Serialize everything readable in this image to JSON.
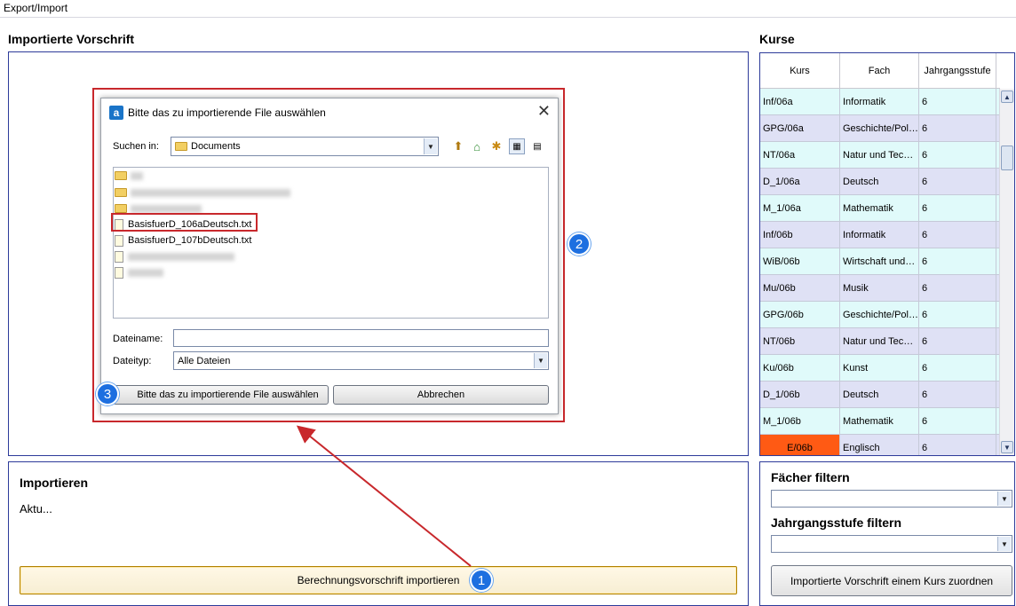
{
  "app": {
    "menu_title": "Export/Import"
  },
  "left_panel": {
    "title": "Importierte Vorschrift"
  },
  "courses": {
    "title": "Kurse",
    "columns": [
      "Kurs",
      "Fach",
      "Jahrgangsstufe"
    ],
    "rows": [
      {
        "kurs": "Inf/06a",
        "fach": "Informatik",
        "stufe": "6"
      },
      {
        "kurs": "GPG/06a",
        "fach": "Geschichte/Pol…",
        "stufe": "6"
      },
      {
        "kurs": "NT/06a",
        "fach": "Natur und Tec…",
        "stufe": "6"
      },
      {
        "kurs": "D_1/06a",
        "fach": "Deutsch",
        "stufe": "6"
      },
      {
        "kurs": "M_1/06a",
        "fach": "Mathematik",
        "stufe": "6"
      },
      {
        "kurs": "Inf/06b",
        "fach": "Informatik",
        "stufe": "6"
      },
      {
        "kurs": "WiB/06b",
        "fach": "Wirtschaft und…",
        "stufe": "6"
      },
      {
        "kurs": "Mu/06b",
        "fach": "Musik",
        "stufe": "6"
      },
      {
        "kurs": "GPG/06b",
        "fach": "Geschichte/Pol…",
        "stufe": "6"
      },
      {
        "kurs": "NT/06b",
        "fach": "Natur und Tec…",
        "stufe": "6"
      },
      {
        "kurs": "Ku/06b",
        "fach": "Kunst",
        "stufe": "6"
      },
      {
        "kurs": "D_1/06b",
        "fach": "Deutsch",
        "stufe": "6"
      },
      {
        "kurs": "M_1/06b",
        "fach": "Mathematik",
        "stufe": "6"
      },
      {
        "kurs": "E/06b",
        "fach": "Englisch",
        "stufe": "6"
      }
    ]
  },
  "import_panel": {
    "title": "Importieren",
    "status": "Aktu...",
    "button_label": "Berechnungsvorschrift importieren"
  },
  "filter_panel": {
    "faecher_label": "Fächer filtern",
    "stufe_label": "Jahrgangsstufe filtern",
    "assign_button": "Importierte Vorschrift einem Kurs zuordnen"
  },
  "dialog": {
    "title": "Bitte das zu importierende File auswählen",
    "logo_letter": "a",
    "look_in_label": "Suchen in:",
    "look_in_value": "Documents",
    "files": [
      "BasisfuerD_106aDeutsch.txt",
      "BasisfuerD_107bDeutsch.txt"
    ],
    "filename_label": "Dateiname:",
    "filename_value": "",
    "filetype_label": "Dateityp:",
    "filetype_value": "Alle Dateien",
    "open_button": "Bitte das zu importierende File auswählen",
    "cancel_button": "Abbrechen"
  },
  "markers": {
    "m1": "1",
    "m2": "2",
    "m3": "3"
  },
  "colors": {
    "panel_border": "#2d3b9a",
    "annotation_red": "#c8282c",
    "marker_blue": "#1d6fe0",
    "selected_cell": "#ff5a14"
  }
}
